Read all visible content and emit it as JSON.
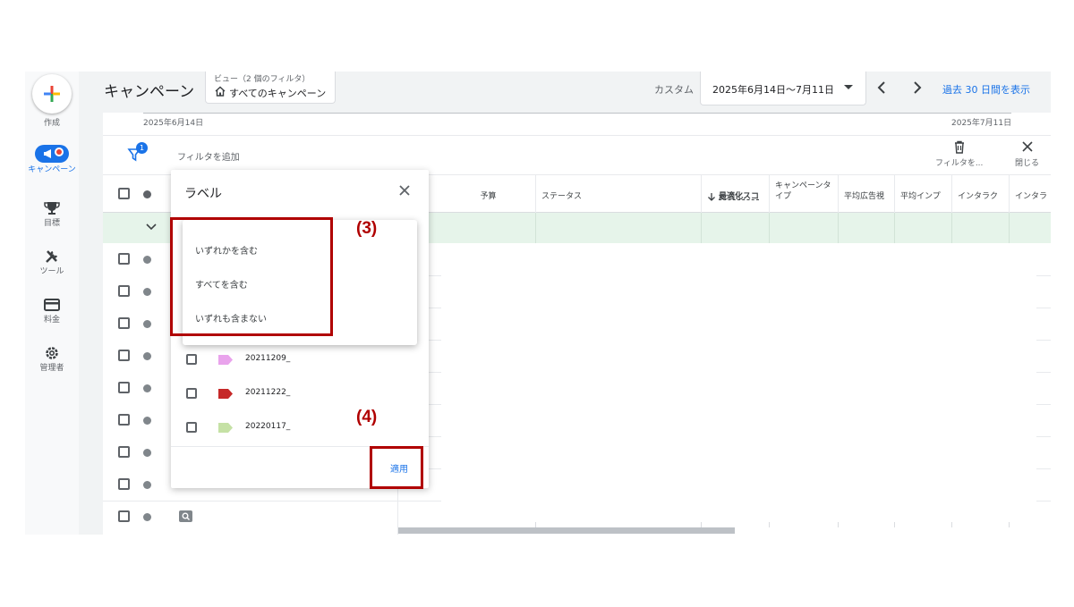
{
  "rail": {
    "create_label": "作成",
    "items": [
      {
        "label": "キャンペーン",
        "icon": "megaphone-icon"
      },
      {
        "label": "目標",
        "icon": "trophy-icon"
      },
      {
        "label": "ツール",
        "icon": "tools-icon"
      },
      {
        "label": "料金",
        "icon": "credit-card-icon"
      },
      {
        "label": "管理者",
        "icon": "gear-icon"
      }
    ]
  },
  "header": {
    "title": "キャンペーン",
    "view_caption": "ビュー（2 個のフィルタ）",
    "view_value": "すべてのキャンペーン",
    "date_mode": "カスタム",
    "date_range": "2025年6月14日〜7月11日",
    "past_link": "過去 30 日間を表示"
  },
  "timeline": {
    "start": "2025年6月14日",
    "end": "2025年7月11日"
  },
  "filter_bar": {
    "filter_badge": "1",
    "add_filter": "フィルタを追加",
    "filter_tool": "フィルタを...",
    "close_tool": "閉じる"
  },
  "table": {
    "columns": [
      "予算",
      "ステータス",
      "最適化スコ",
      "キャンペーンタイプ",
      "平均広告視",
      "平均インプ",
      "インタラク",
      "インタラ"
    ],
    "sort_column": "最適化スコ"
  },
  "panel": {
    "title": "ラベル",
    "labels": [
      {
        "text": "20211209_",
        "color": "#e9a3ec"
      },
      {
        "text": "20211222_",
        "color": "#c62828"
      },
      {
        "text": "20220117_",
        "color": "#c5e1a5"
      }
    ],
    "apply": "適用"
  },
  "menu": {
    "items": [
      "いずれかを含む",
      "すべてを含む",
      "いずれも含まない"
    ]
  },
  "annotations": {
    "step3": "(3)",
    "step4": "(4)",
    "color": "#b00000"
  }
}
